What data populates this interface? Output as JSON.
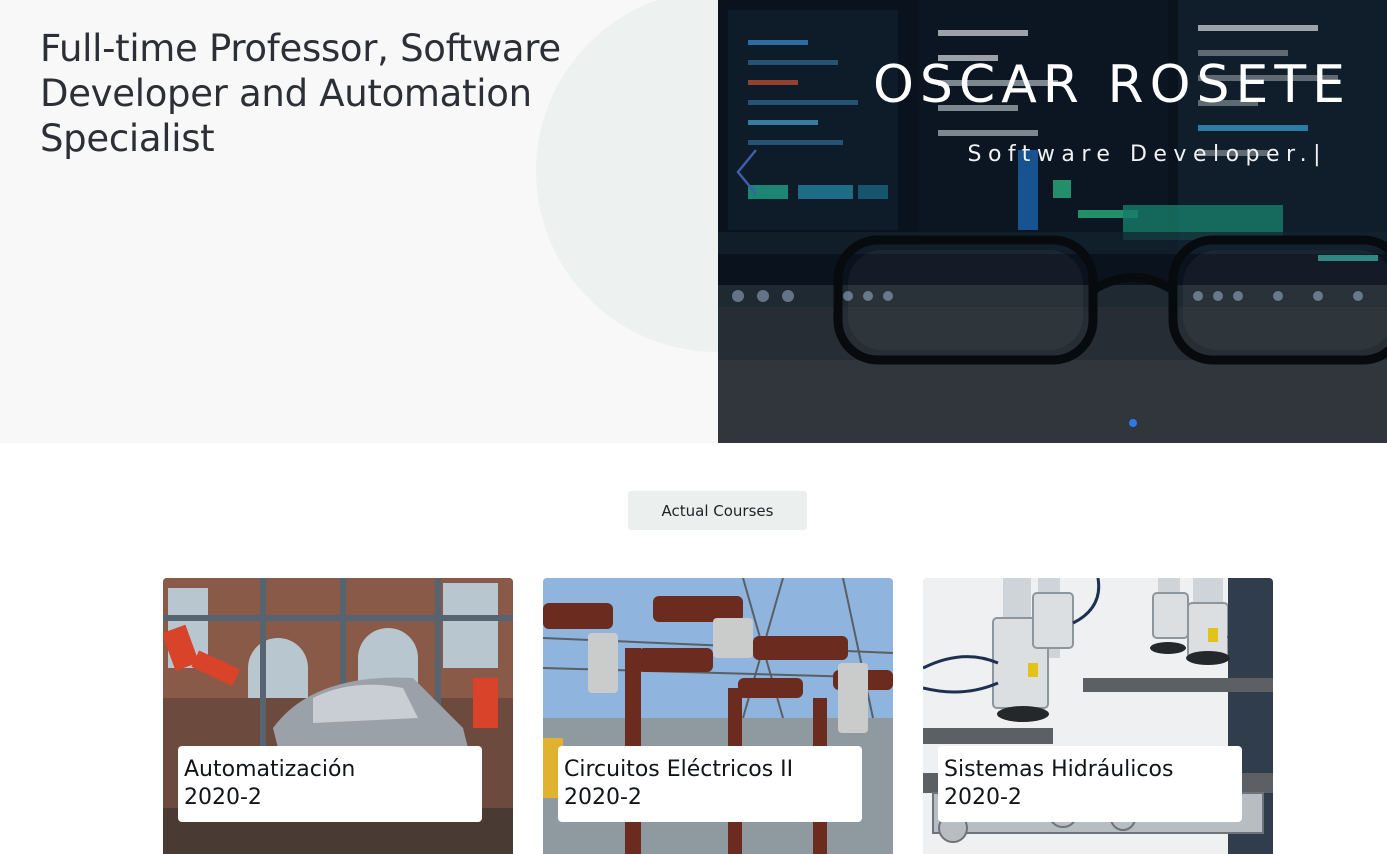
{
  "hero": {
    "headline": "Full-time Professor, Software Developer and Automation Specialist",
    "name": "OSCAR ROSETE",
    "role": "Software Developer.|",
    "dot_color": "#2c7ae6"
  },
  "courses_section": {
    "badge": "Actual Courses"
  },
  "courses": [
    {
      "name": "Automatización",
      "term": "2020-2"
    },
    {
      "name": "Circuitos Eléctricos II",
      "term": "2020-2"
    },
    {
      "name": "Sistemas Hidráulicos",
      "term": "2020-2"
    }
  ],
  "icons": {
    "carousel_prev": "chevron-left-icon"
  }
}
